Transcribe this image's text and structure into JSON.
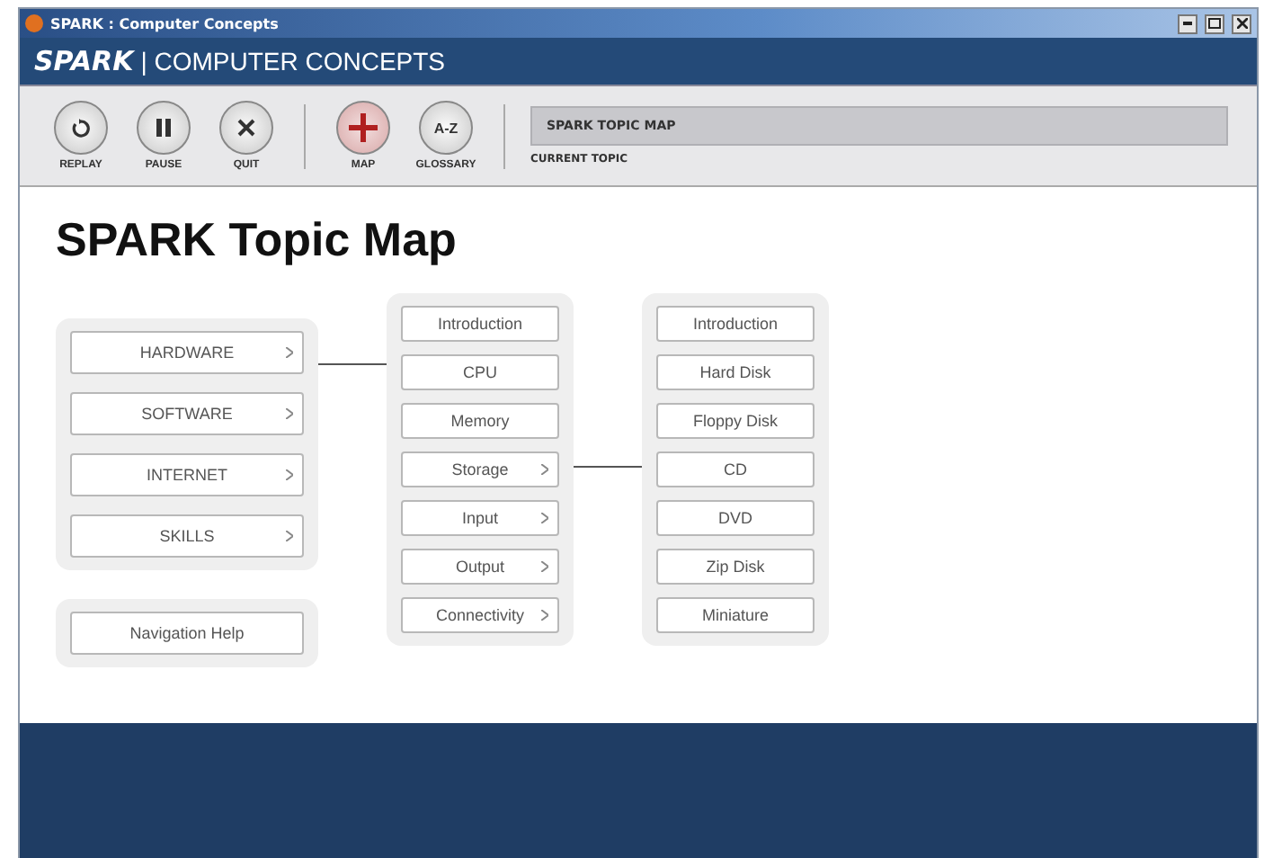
{
  "window": {
    "title": "SPARK : Computer Concepts"
  },
  "header": {
    "brand": "SPARK",
    "title": "| COMPUTER CONCEPTS"
  },
  "toolbar": {
    "groups": [
      [
        {
          "kind": "replay",
          "label": "REPLAY"
        },
        {
          "kind": "pause",
          "label": "PAUSE"
        },
        {
          "kind": "quit",
          "label": "QUIT"
        }
      ],
      [
        {
          "kind": "map",
          "label": "MAP"
        },
        {
          "kind": "glossary",
          "label": "GLOSSARY",
          "glyph": "A-Z"
        }
      ]
    ],
    "current_topic": {
      "value": "SPARK TOPIC MAP",
      "label": "CURRENT TOPIC"
    }
  },
  "page_title": "SPARK Topic Map",
  "menus": [
    {
      "items": [
        {
          "label": "HARDWARE",
          "submenu": true
        },
        {
          "label": "SOFTWARE",
          "submenu": true
        },
        {
          "label": "INTERNET",
          "submenu": true
        },
        {
          "label": "SKILLS",
          "submenu": true
        }
      ],
      "extra": {
        "label": "Navigation Help",
        "submenu": false
      }
    },
    {
      "items": [
        {
          "label": "Introduction",
          "submenu": false
        },
        {
          "label": "CPU",
          "submenu": false
        },
        {
          "label": "Memory",
          "submenu": false
        },
        {
          "label": "Storage",
          "submenu": true
        },
        {
          "label": "Input",
          "submenu": true
        },
        {
          "label": "Output",
          "submenu": true
        },
        {
          "label": "Connectivity",
          "submenu": true
        }
      ]
    },
    {
      "items": [
        {
          "label": "Introduction",
          "submenu": false
        },
        {
          "label": "Hard Disk",
          "submenu": false
        },
        {
          "label": "Floppy Disk",
          "submenu": false
        },
        {
          "label": "CD",
          "submenu": false
        },
        {
          "label": "DVD",
          "submenu": false
        },
        {
          "label": "Zip Disk",
          "submenu": false
        },
        {
          "label": "Miniature",
          "submenu": false
        }
      ]
    }
  ]
}
